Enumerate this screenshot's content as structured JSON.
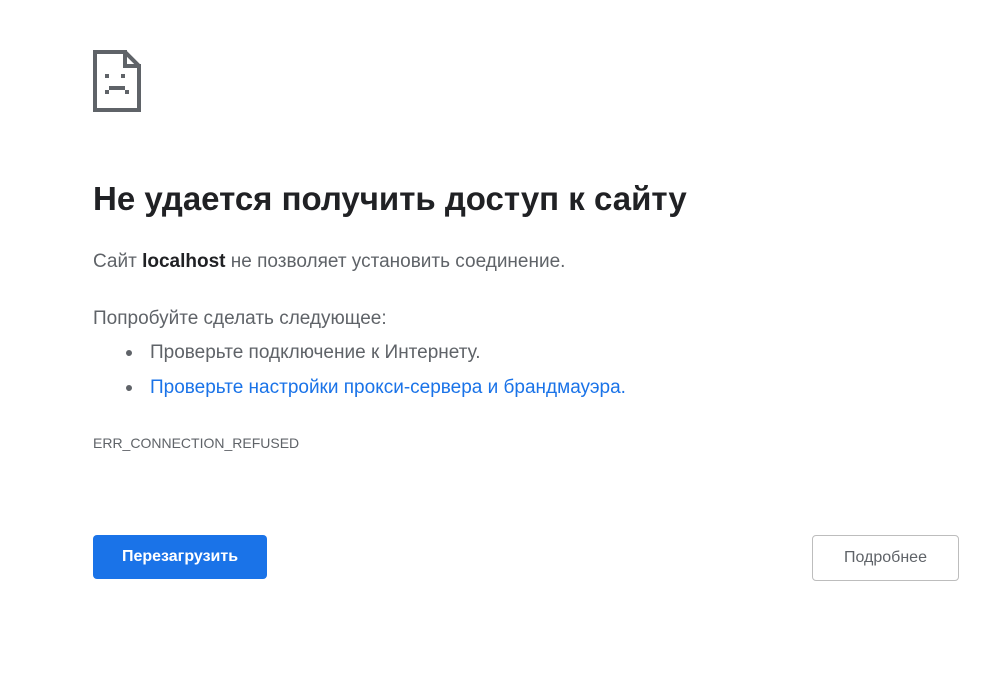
{
  "icon": "sad-page-icon",
  "heading": "Не удается получить доступ к сайту",
  "summary": {
    "prefix": "Сайт ",
    "host": "localhost",
    "suffix": " не позволяет установить соединение."
  },
  "suggestions": {
    "title": "Попробуйте сделать следующее:",
    "items": [
      {
        "text": "Проверьте подключение к Интернету.",
        "is_link": false
      },
      {
        "text": "Проверьте настройки прокси-сервера и брандмауэра.",
        "is_link": true
      }
    ]
  },
  "error_code": "ERR_CONNECTION_REFUSED",
  "buttons": {
    "reload_label": "Перезагрузить",
    "details_label": "Подробнее"
  },
  "colors": {
    "accent": "#1a73e8",
    "text_primary": "#202124",
    "text_secondary": "#5f6368"
  }
}
